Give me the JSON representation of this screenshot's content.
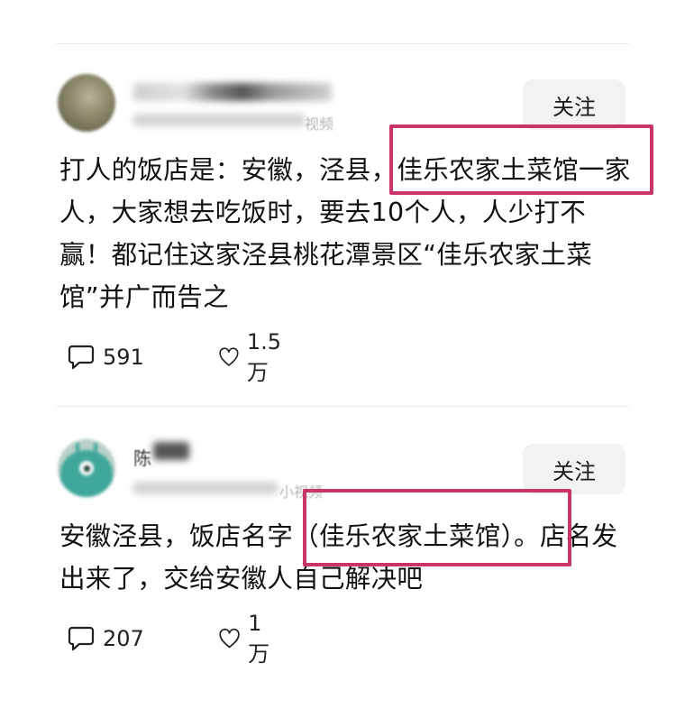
{
  "posts": [
    {
      "follow_label": "关注",
      "subtitle_tail": "视频",
      "content": "打人的饭店是：安徽，泾县，佳乐农家土菜馆一家人，大家想去吃饭时，要去10个人，人少打不赢！都记住这家泾县桃花潭景区“佳乐农家土菜馆”并广而告之",
      "comments": "591",
      "likes": "1.5万"
    },
    {
      "follow_label": "关注",
      "name_fragment": "陈",
      "subtitle_tail": "小视频",
      "content": "安徽泾县，饭店名字（佳乐农家土菜馆）。店名发出来了，交给安徽人自己解决吧",
      "comments": "207",
      "likes": "1万"
    }
  ],
  "icons": {
    "comment": "comment-bubble-icon",
    "like": "heart-outline-icon"
  },
  "colors": {
    "highlight": "#c8356a",
    "follow_bg": "#f2f2f2"
  }
}
